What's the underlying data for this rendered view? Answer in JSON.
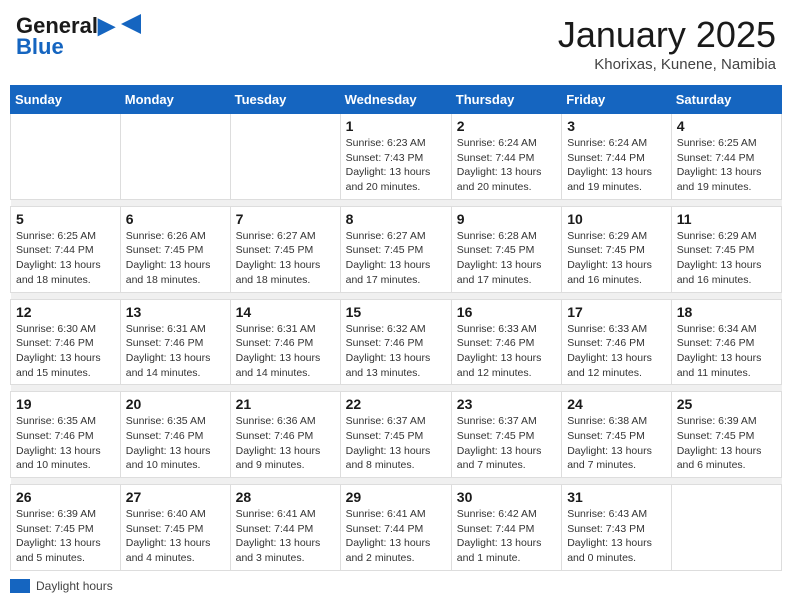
{
  "header": {
    "logo_line1": "General",
    "logo_line2": "Blue",
    "title": "January 2025",
    "subtitle": "Khorixas, Kunene, Namibia"
  },
  "days_of_week": [
    "Sunday",
    "Monday",
    "Tuesday",
    "Wednesday",
    "Thursday",
    "Friday",
    "Saturday"
  ],
  "weeks": [
    [
      {
        "day": "",
        "info": ""
      },
      {
        "day": "",
        "info": ""
      },
      {
        "day": "",
        "info": ""
      },
      {
        "day": "1",
        "info": "Sunrise: 6:23 AM\nSunset: 7:43 PM\nDaylight: 13 hours\nand 20 minutes."
      },
      {
        "day": "2",
        "info": "Sunrise: 6:24 AM\nSunset: 7:44 PM\nDaylight: 13 hours\nand 20 minutes."
      },
      {
        "day": "3",
        "info": "Sunrise: 6:24 AM\nSunset: 7:44 PM\nDaylight: 13 hours\nand 19 minutes."
      },
      {
        "day": "4",
        "info": "Sunrise: 6:25 AM\nSunset: 7:44 PM\nDaylight: 13 hours\nand 19 minutes."
      }
    ],
    [
      {
        "day": "5",
        "info": "Sunrise: 6:25 AM\nSunset: 7:44 PM\nDaylight: 13 hours\nand 18 minutes."
      },
      {
        "day": "6",
        "info": "Sunrise: 6:26 AM\nSunset: 7:45 PM\nDaylight: 13 hours\nand 18 minutes."
      },
      {
        "day": "7",
        "info": "Sunrise: 6:27 AM\nSunset: 7:45 PM\nDaylight: 13 hours\nand 18 minutes."
      },
      {
        "day": "8",
        "info": "Sunrise: 6:27 AM\nSunset: 7:45 PM\nDaylight: 13 hours\nand 17 minutes."
      },
      {
        "day": "9",
        "info": "Sunrise: 6:28 AM\nSunset: 7:45 PM\nDaylight: 13 hours\nand 17 minutes."
      },
      {
        "day": "10",
        "info": "Sunrise: 6:29 AM\nSunset: 7:45 PM\nDaylight: 13 hours\nand 16 minutes."
      },
      {
        "day": "11",
        "info": "Sunrise: 6:29 AM\nSunset: 7:45 PM\nDaylight: 13 hours\nand 16 minutes."
      }
    ],
    [
      {
        "day": "12",
        "info": "Sunrise: 6:30 AM\nSunset: 7:46 PM\nDaylight: 13 hours\nand 15 minutes."
      },
      {
        "day": "13",
        "info": "Sunrise: 6:31 AM\nSunset: 7:46 PM\nDaylight: 13 hours\nand 14 minutes."
      },
      {
        "day": "14",
        "info": "Sunrise: 6:31 AM\nSunset: 7:46 PM\nDaylight: 13 hours\nand 14 minutes."
      },
      {
        "day": "15",
        "info": "Sunrise: 6:32 AM\nSunset: 7:46 PM\nDaylight: 13 hours\nand 13 minutes."
      },
      {
        "day": "16",
        "info": "Sunrise: 6:33 AM\nSunset: 7:46 PM\nDaylight: 13 hours\nand 12 minutes."
      },
      {
        "day": "17",
        "info": "Sunrise: 6:33 AM\nSunset: 7:46 PM\nDaylight: 13 hours\nand 12 minutes."
      },
      {
        "day": "18",
        "info": "Sunrise: 6:34 AM\nSunset: 7:46 PM\nDaylight: 13 hours\nand 11 minutes."
      }
    ],
    [
      {
        "day": "19",
        "info": "Sunrise: 6:35 AM\nSunset: 7:46 PM\nDaylight: 13 hours\nand 10 minutes."
      },
      {
        "day": "20",
        "info": "Sunrise: 6:35 AM\nSunset: 7:46 PM\nDaylight: 13 hours\nand 10 minutes."
      },
      {
        "day": "21",
        "info": "Sunrise: 6:36 AM\nSunset: 7:46 PM\nDaylight: 13 hours\nand 9 minutes."
      },
      {
        "day": "22",
        "info": "Sunrise: 6:37 AM\nSunset: 7:45 PM\nDaylight: 13 hours\nand 8 minutes."
      },
      {
        "day": "23",
        "info": "Sunrise: 6:37 AM\nSunset: 7:45 PM\nDaylight: 13 hours\nand 7 minutes."
      },
      {
        "day": "24",
        "info": "Sunrise: 6:38 AM\nSunset: 7:45 PM\nDaylight: 13 hours\nand 7 minutes."
      },
      {
        "day": "25",
        "info": "Sunrise: 6:39 AM\nSunset: 7:45 PM\nDaylight: 13 hours\nand 6 minutes."
      }
    ],
    [
      {
        "day": "26",
        "info": "Sunrise: 6:39 AM\nSunset: 7:45 PM\nDaylight: 13 hours\nand 5 minutes."
      },
      {
        "day": "27",
        "info": "Sunrise: 6:40 AM\nSunset: 7:45 PM\nDaylight: 13 hours\nand 4 minutes."
      },
      {
        "day": "28",
        "info": "Sunrise: 6:41 AM\nSunset: 7:44 PM\nDaylight: 13 hours\nand 3 minutes."
      },
      {
        "day": "29",
        "info": "Sunrise: 6:41 AM\nSunset: 7:44 PM\nDaylight: 13 hours\nand 2 minutes."
      },
      {
        "day": "30",
        "info": "Sunrise: 6:42 AM\nSunset: 7:44 PM\nDaylight: 13 hours\nand 1 minute."
      },
      {
        "day": "31",
        "info": "Sunrise: 6:43 AM\nSunset: 7:43 PM\nDaylight: 13 hours\nand 0 minutes."
      },
      {
        "day": "",
        "info": ""
      }
    ]
  ],
  "legend": {
    "label": "Daylight hours"
  }
}
